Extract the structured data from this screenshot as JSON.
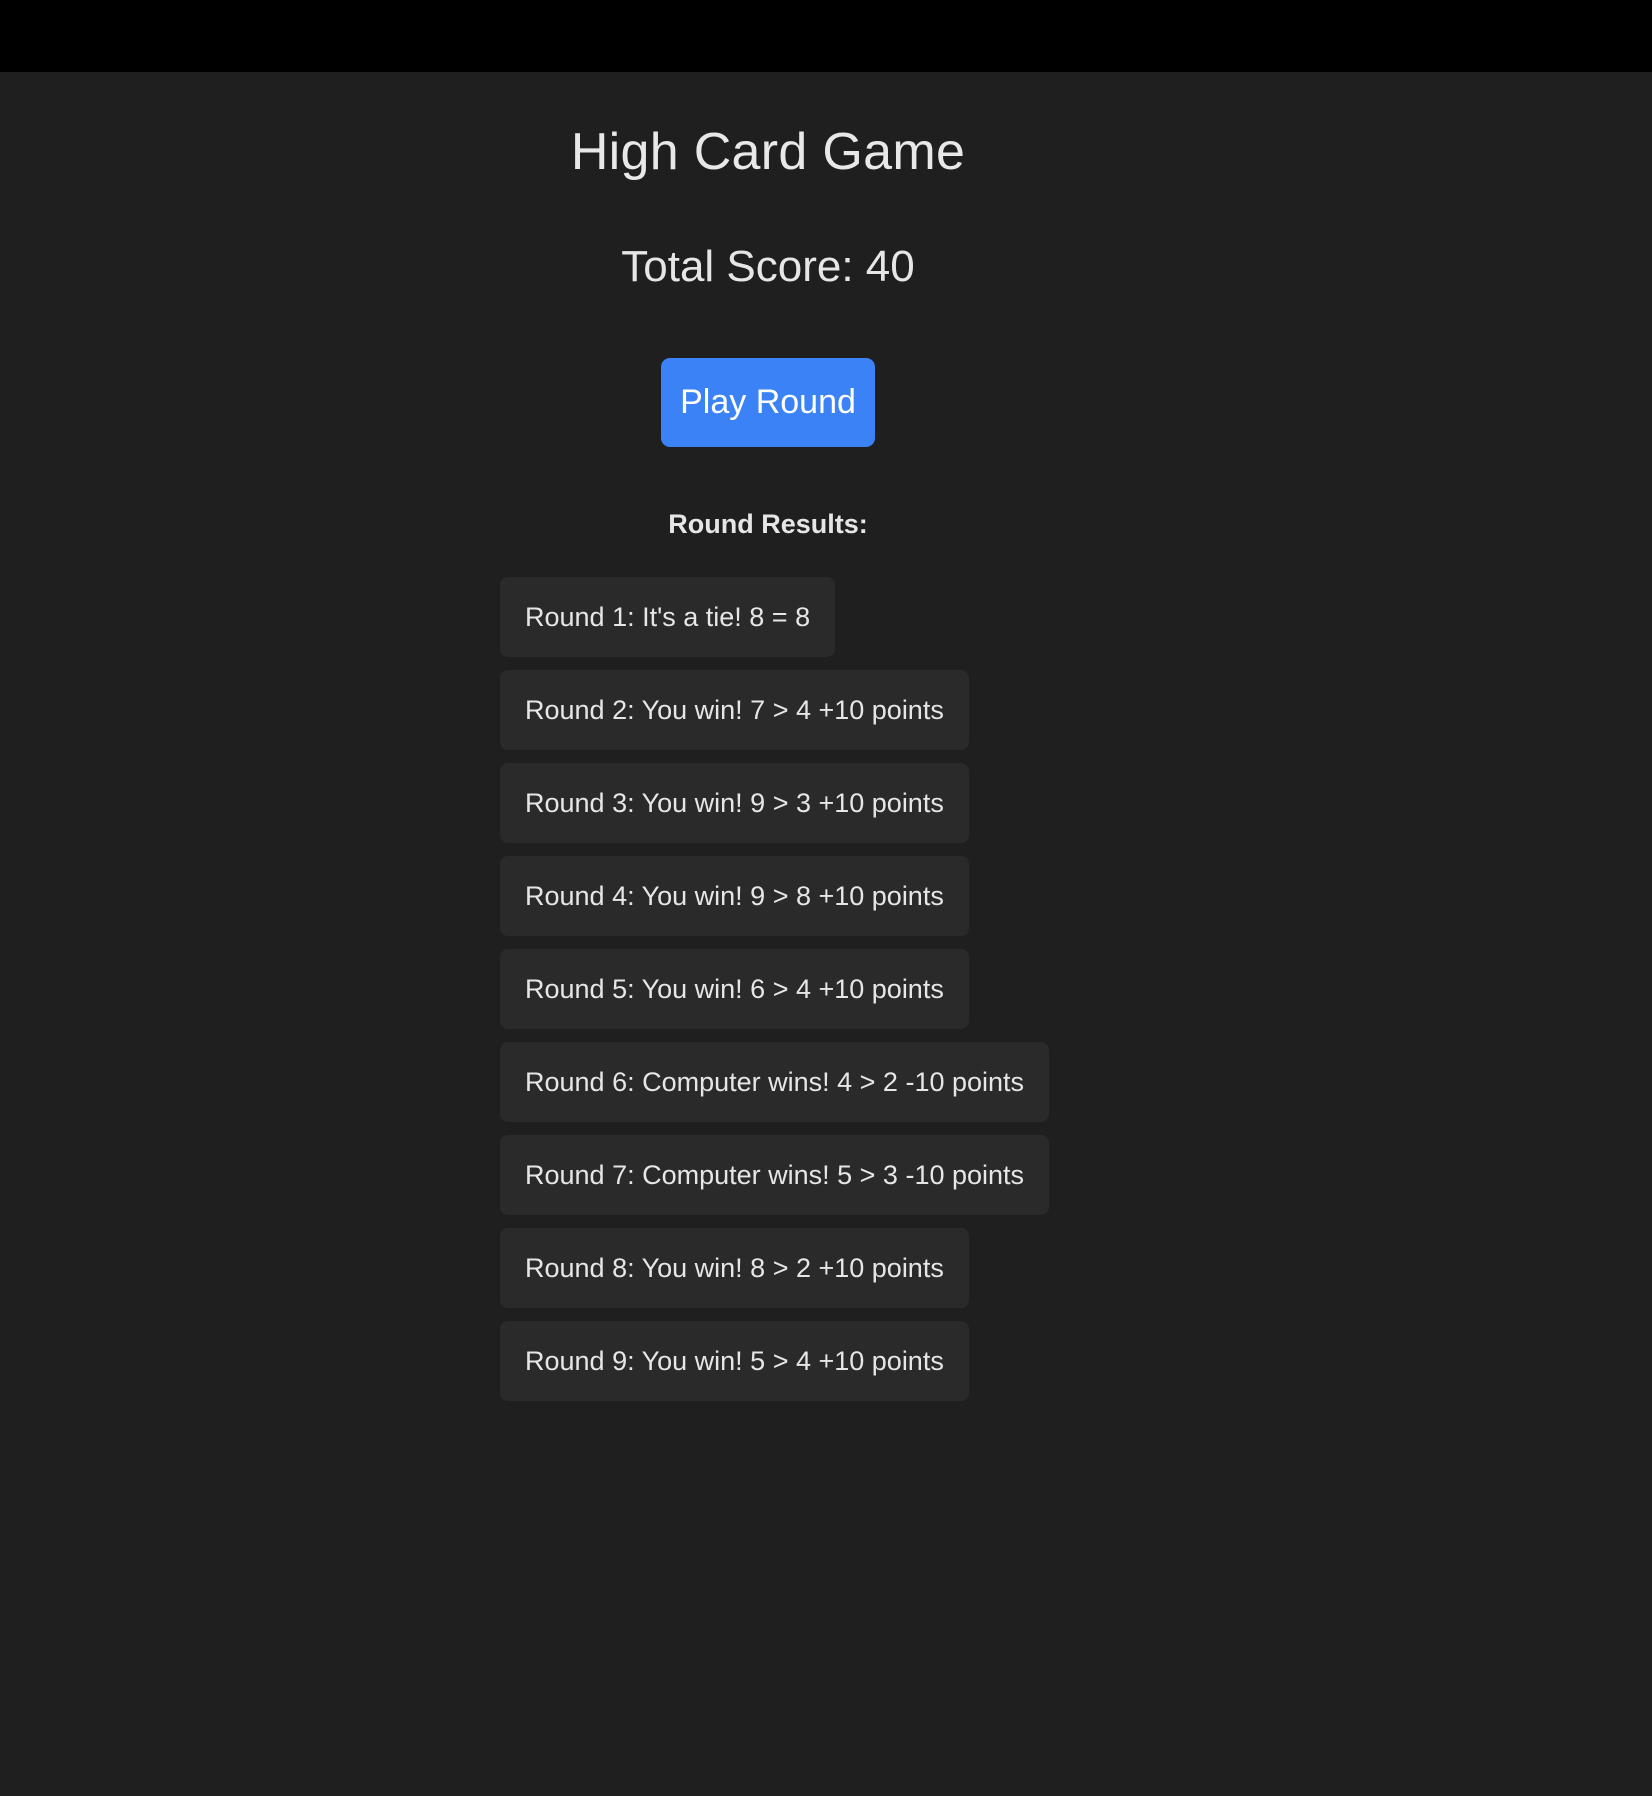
{
  "app": {
    "title": "High Card Game",
    "score_text": "Total Score: 40",
    "play_button_label": "Play Round",
    "results_heading": "Round Results:",
    "results": [
      "Round 1: It's a tie! 8 = 8",
      "Round 2: You win! 7 > 4 +10 points",
      "Round 3: You win! 9 > 3 +10 points",
      "Round 4: You win! 9 > 8 +10 points",
      "Round 5: You win! 6 > 4 +10 points",
      "Round 6: Computer wins! 4 > 2 -10 points",
      "Round 7: Computer wins! 5 > 3 -10 points",
      "Round 8: You win! 8 > 2 +10 points",
      "Round 9: You win! 5 > 4 +10 points"
    ]
  },
  "colors": {
    "background": "#1f1f1f",
    "top_bar": "#000000",
    "accent_button": "#3b82f6",
    "result_card": "#2a2a2a",
    "text": "#e6e6e6"
  }
}
